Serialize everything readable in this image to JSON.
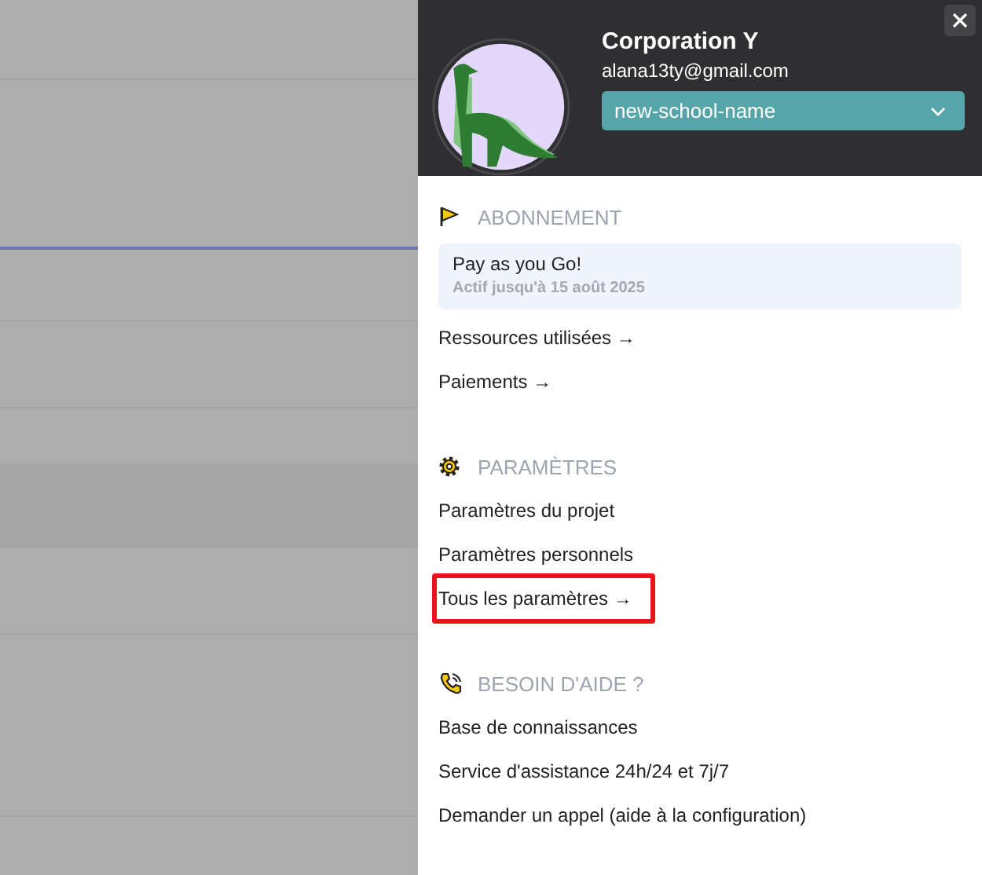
{
  "profile": {
    "name": "Corporation Y",
    "email": "alana13ty@gmail.com",
    "workspace": "new-school-name"
  },
  "sections": [
    {
      "kind": "subscription",
      "title": "ABONNEMENT",
      "plan": {
        "name": "Pay as you Go!",
        "validity": "Actif jusqu'à 15 août 2025"
      },
      "links": [
        {
          "label": "Ressources utilisées →",
          "highlighted": false
        },
        {
          "label": "Paiements →",
          "highlighted": false
        }
      ]
    },
    {
      "kind": "settings",
      "title": "PARAMÈTRES",
      "links": [
        {
          "label": "Paramètres du projet",
          "highlighted": false
        },
        {
          "label": "Paramètres personnels",
          "highlighted": false
        },
        {
          "label": "Tous les paramètres →",
          "highlighted": true
        }
      ]
    },
    {
      "kind": "help",
      "title": "BESOIN D'AIDE ?",
      "links": [
        {
          "label": "Base de connaissances",
          "highlighted": false
        },
        {
          "label": "Service d'assistance 24h/24 et 7j/7",
          "highlighted": false
        },
        {
          "label": "Demander un appel (aide à la configuration)",
          "highlighted": false
        }
      ]
    }
  ]
}
